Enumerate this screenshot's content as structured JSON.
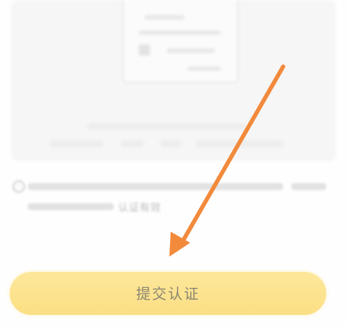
{
  "notice": {
    "text": "认证有效"
  },
  "submit": {
    "label": "提交认证"
  },
  "annotation": {
    "arrow_color": "#f28a3c",
    "icon": "pointer-arrow-icon"
  },
  "colors": {
    "button_bg": "#fde79b",
    "button_text": "#8c8773",
    "page_bg": "#fefefe"
  }
}
